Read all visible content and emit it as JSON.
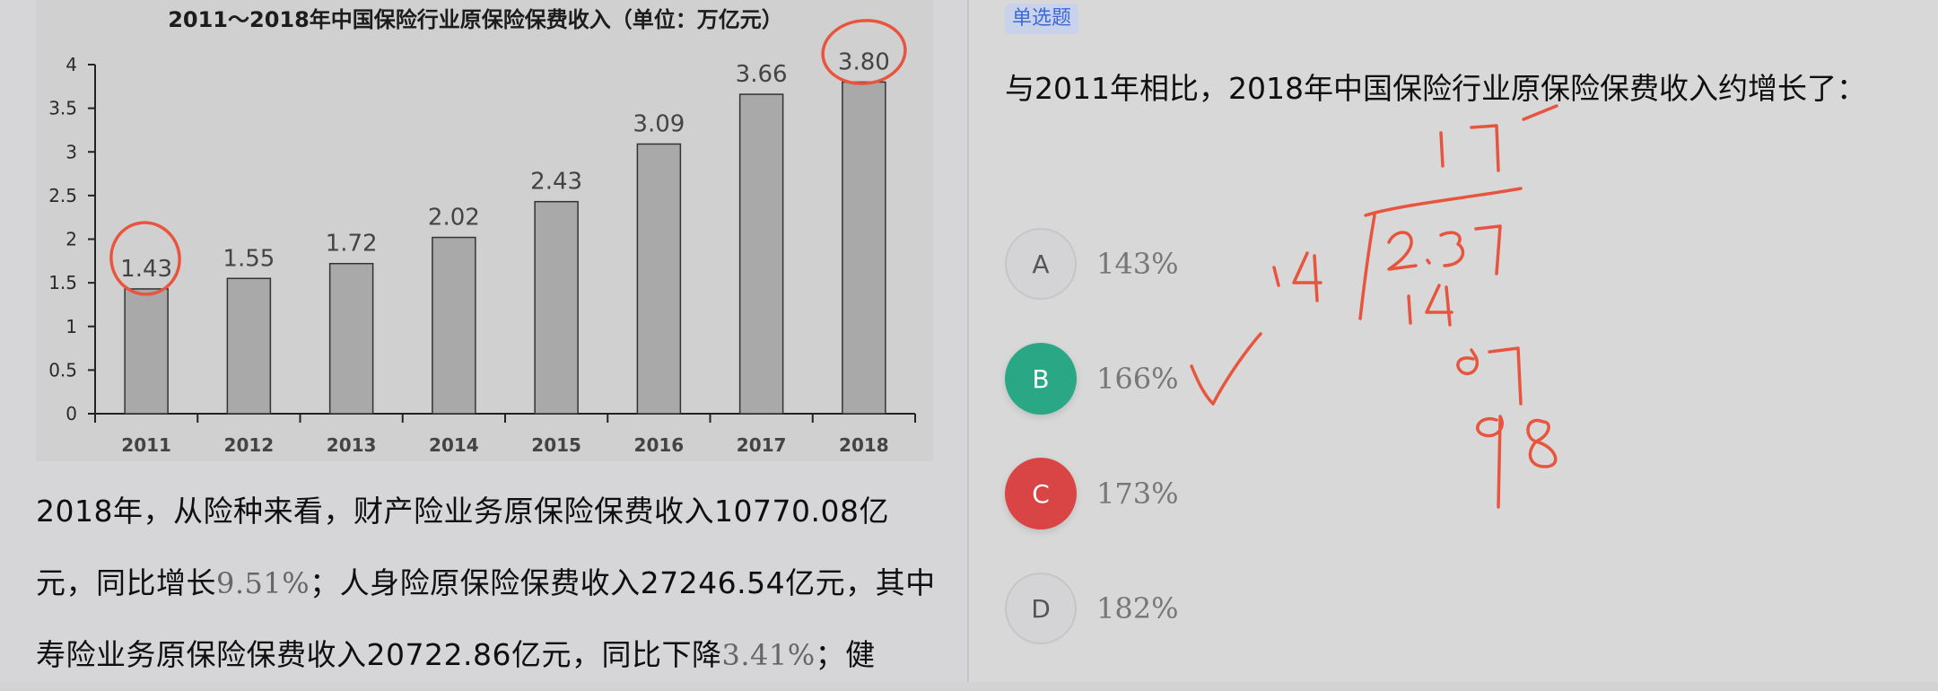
{
  "chart_data": {
    "type": "bar",
    "title": "2011～2018年中国保险行业原保险保费收入（单位：万亿元）",
    "categories": [
      "2011",
      "2012",
      "2013",
      "2014",
      "2015",
      "2016",
      "2017",
      "2018"
    ],
    "values": [
      1.43,
      1.55,
      1.72,
      2.02,
      2.43,
      3.09,
      3.66,
      3.8
    ],
    "data_labels": [
      "1.43",
      "1.55",
      "1.72",
      "2.02",
      "2.43",
      "3.09",
      "3.66",
      "3.80"
    ],
    "yticks": [
      "0",
      "0.5",
      "1",
      "1.5",
      "2",
      "2.5",
      "3",
      "3.5",
      "4"
    ],
    "ylim": [
      0,
      4
    ],
    "xlabel": "",
    "ylabel": "",
    "bar_color": "#aaa9aa",
    "grid": false
  },
  "passage": {
    "seg1": "2018年，从险种来看，财产险业务原保险保费收入10770.08亿元，同比增长",
    "pct1": "9.51%",
    "seg2": "；人身险原保险保费收入27246.54亿元，其中寿险业务原保险保费收入20722.86亿元，同比下降",
    "pct2": "3.41%",
    "seg3": "；健"
  },
  "question": {
    "type_badge": "单选题",
    "stem": "与2011年相比，2018年中国保险行业原保险保费收入约增长了：",
    "options": [
      {
        "letter": "A",
        "text": "143%",
        "state": "neutral"
      },
      {
        "letter": "B",
        "text": "166%",
        "state": "correct"
      },
      {
        "letter": "C",
        "text": "173%",
        "state": "wrong"
      },
      {
        "letter": "D",
        "text": "182%",
        "state": "neutral"
      }
    ]
  },
  "colors": {
    "correct": "#2aa886",
    "wrong": "#d94445",
    "badge_text": "#3d6bd6",
    "annotation": "#e8553e"
  }
}
